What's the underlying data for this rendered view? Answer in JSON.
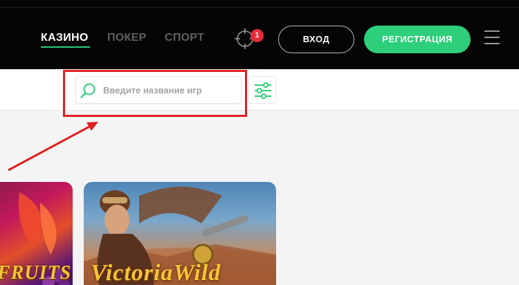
{
  "nav": {
    "items": [
      {
        "label": "КАЗИНО",
        "active": true
      },
      {
        "label": "ПОКЕР",
        "active": false
      },
      {
        "label": "СПОРТ",
        "active": false
      }
    ]
  },
  "header": {
    "notification_count": "1",
    "login_label": "ВХОД",
    "register_label": "РЕГИСТРАЦИЯ"
  },
  "search": {
    "placeholder": "Введите название игр",
    "value": ""
  },
  "icons": {
    "target": "crosshair-icon",
    "search": "magnifier-icon",
    "filter": "sliders-icon",
    "menu": "hamburger-icon"
  },
  "games": [
    {
      "title": "FRUITS"
    },
    {
      "title": "VictoriaWild"
    }
  ],
  "colors": {
    "header_bg": "#050505",
    "accent": "#2ecf7a",
    "badge": "#e62b38",
    "annotation": "#e01e1e",
    "page_bg": "#f4f4f4"
  }
}
